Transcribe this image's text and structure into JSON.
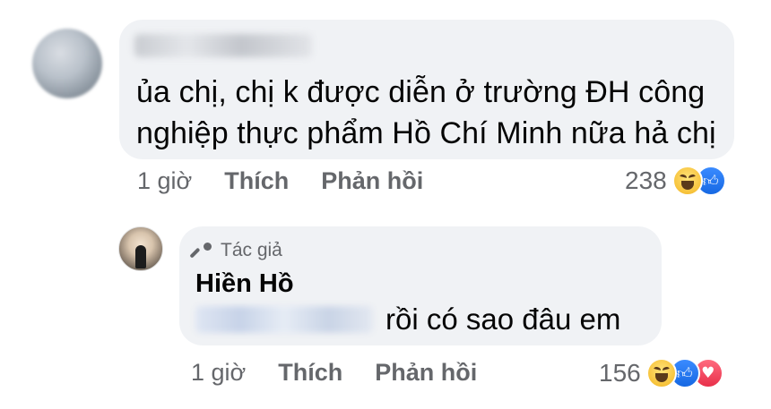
{
  "comment": {
    "text": "ủa chị, chị k được diễn ở trường ĐH công\nnghiệp thực phẩm Hồ Chí Minh nữa hả chị",
    "time": "1 giờ",
    "like_label": "Thích",
    "reply_label": "Phản hồi",
    "reaction_count": "238",
    "reactions": [
      "haha",
      "like"
    ]
  },
  "reply": {
    "badge_label": "Tác giả",
    "author": "Hiền Hồ",
    "text": "rồi có sao đâu em",
    "time": "1 giờ",
    "like_label": "Thích",
    "reply_label": "Phản hồi",
    "reaction_count": "156",
    "reactions": [
      "haha",
      "like",
      "love"
    ]
  },
  "colors": {
    "bubble": "#f0f2f5",
    "meta_text": "#65676b",
    "like_blue": "#1668e3",
    "love_red": "#e8304a"
  }
}
